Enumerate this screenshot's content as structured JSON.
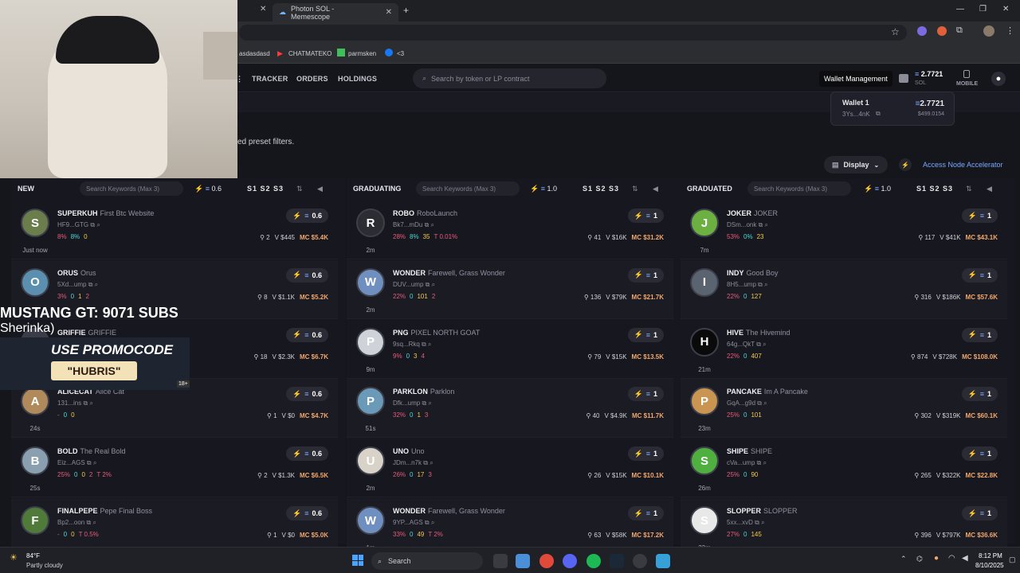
{
  "browser": {
    "tabs": [
      {
        "label": "Photon SOL - Memescope"
      }
    ],
    "bookmarks": [
      "asdasdasd",
      "CHATMATEKO",
      "parmsken",
      "<3"
    ]
  },
  "nav": {
    "tracker": "TRACKER",
    "orders": "ORDERS",
    "holdings": "HOLDINGS",
    "search_placeholder": "Search by token or LP contract",
    "tooltip": "Wallet Management",
    "balance": "2.7721",
    "balance_unit": "SOL",
    "mobile": "MOBILE"
  },
  "wallet_popup": {
    "name": "Wallet 1",
    "addr": "3Ys...4nK",
    "sol": "2.7721",
    "usd": "$499.0154"
  },
  "toolbar": {
    "preset_text": "ed preset filters.",
    "display": "Display",
    "access": "Access Node Accelerator"
  },
  "columns": [
    {
      "title": "NEW",
      "kw_placeholder": "Search Keywords (Max 3)",
      "preset_value": "0.6",
      "slots": "S1 S2 S3",
      "rows": [
        {
          "ticker": "SUPERKUH",
          "name": "First Btc Website",
          "addr": "HF9...GTG",
          "s1": "8%",
          "s2": "8%",
          "s3": "0",
          "s4": "",
          "s5": "",
          "holders": "2",
          "vol": "V $445",
          "mc": "MC $5.4K",
          "age": "Just now",
          "chip": "0.6",
          "av": "S",
          "avc": "#6a7d4a"
        },
        {
          "ticker": "ORUS",
          "name": "Orus",
          "addr": "5Xd...ump",
          "s1": "3%",
          "s2": "0",
          "s3": "1",
          "s4": "2",
          "s5": "",
          "holders": "8",
          "vol": "V $1.1K",
          "mc": "MC $5.2K",
          "age": "",
          "chip": "0.6",
          "av": "O",
          "avc": "#5a8fb0"
        },
        {
          "ticker": "GRIFFIE",
          "name": "GRIFFIE",
          "addr": "",
          "s1": "",
          "s2": "",
          "s3": "",
          "s4": "",
          "s5": "",
          "holders": "18",
          "vol": "V $2.3K",
          "mc": "MC $6.7K",
          "age": "",
          "chip": "0.6",
          "av": "G",
          "avc": "#3a3c48"
        },
        {
          "ticker": "ALICECAT",
          "name": "Alice Cat",
          "addr": "131...ins",
          "s1": "-",
          "s2": "0",
          "s3": "0",
          "s4": "",
          "s5": "",
          "holders": "1",
          "vol": "V $0",
          "mc": "MC $4.7K",
          "age": "24s",
          "chip": "0.6",
          "av": "A",
          "avc": "#b08a5a"
        },
        {
          "ticker": "BOLD",
          "name": "The Real Bold",
          "addr": "Eiz...AGS",
          "s1": "25%",
          "s2": "0",
          "s3": "0",
          "s4": "2",
          "s5": "T 2%",
          "holders": "2",
          "vol": "V $1.3K",
          "mc": "MC $6.5K",
          "age": "25s",
          "chip": "0.6",
          "av": "B",
          "avc": "#8aa0b0"
        },
        {
          "ticker": "FINALPEPE",
          "name": "Pepe Final Boss",
          "addr": "Bp2...oon",
          "s1": "-",
          "s2": "0",
          "s3": "0",
          "s4": "",
          "s5": "T 0.5%",
          "holders": "1",
          "vol": "V $0",
          "mc": "MC $5.0K",
          "age": "",
          "chip": "0.6",
          "av": "F",
          "avc": "#4f7a3a"
        }
      ]
    },
    {
      "title": "GRADUATING",
      "kw_placeholder": "Search Keywords (Max 3)",
      "preset_value": "1.0",
      "slots": "S1 S2 S3",
      "rows": [
        {
          "ticker": "ROBO",
          "name": "RoboLaunch",
          "addr": "Bk7...mDu",
          "s1": "28%",
          "s2": "8%",
          "s3": "35",
          "s4": "",
          "s5": "T 0.01%",
          "holders": "41",
          "vol": "V $16K",
          "mc": "MC $31.2K",
          "age": "2m",
          "chip": "1",
          "av": "R",
          "avc": "#2b2d33"
        },
        {
          "ticker": "WONDER",
          "name": "Farewell, Grass Wonder",
          "addr": "DUV...ump",
          "s1": "22%",
          "s2": "0",
          "s3": "101",
          "s4": "2",
          "s5": "",
          "holders": "136",
          "vol": "V $79K",
          "mc": "MC $21.7K",
          "age": "2m",
          "chip": "1",
          "av": "W",
          "avc": "#6f8fc0"
        },
        {
          "ticker": "PNG",
          "name": "PIXEL NORTH GOAT",
          "addr": "9sq...Rkq",
          "s1": "9%",
          "s2": "0",
          "s3": "3",
          "s4": "4",
          "s5": "",
          "holders": "79",
          "vol": "V $15K",
          "mc": "MC $13.5K",
          "age": "9m",
          "chip": "1",
          "av": "P",
          "avc": "#cfd2d8"
        },
        {
          "ticker": "PARKLON",
          "name": "Parklon",
          "addr": "Dfk...ump",
          "s1": "32%",
          "s2": "0",
          "s3": "1",
          "s4": "3",
          "s5": "",
          "holders": "40",
          "vol": "V $4.9K",
          "mc": "MC $11.7K",
          "age": "51s",
          "chip": "1",
          "av": "P",
          "avc": "#6a9ab8"
        },
        {
          "ticker": "UNO",
          "name": "Uno",
          "addr": "JDm...n7k",
          "s1": "26%",
          "s2": "0",
          "s3": "17",
          "s4": "3",
          "s5": "",
          "holders": "26",
          "vol": "V $15K",
          "mc": "MC $10.1K",
          "age": "2m",
          "chip": "1",
          "av": "U",
          "avc": "#d8d2c8"
        },
        {
          "ticker": "WONDER",
          "name": "Farewell, Grass Wonder",
          "addr": "9YP...AGS",
          "s1": "33%",
          "s2": "0",
          "s3": "49",
          "s4": "",
          "s5": "T 2%",
          "holders": "63",
          "vol": "V $58K",
          "mc": "MC $17.2K",
          "age": "1m",
          "chip": "1",
          "av": "W",
          "avc": "#6f8fc0"
        }
      ]
    },
    {
      "title": "GRADUATED",
      "kw_placeholder": "Search Keywords (Max 3)",
      "preset_value": "1.0",
      "slots": "S1 S2 S3",
      "rows": [
        {
          "ticker": "JOKER",
          "name": "JOKER",
          "addr": "DSm...onk",
          "s1": "53%",
          "s2": "0%",
          "s3": "23",
          "s4": "",
          "s5": "",
          "holders": "117",
          "vol": "V $41K",
          "mc": "MC $43.1K",
          "age": "7m",
          "chip": "1",
          "av": "J",
          "avc": "#6bb040"
        },
        {
          "ticker": "INDY",
          "name": "Good Boy",
          "addr": "8H5...ump",
          "s1": "22%",
          "s2": "0",
          "s3": "127",
          "s4": "",
          "s5": "",
          "holders": "316",
          "vol": "V $186K",
          "mc": "MC $57.6K",
          "age": "",
          "chip": "1",
          "av": "I",
          "avc": "#5a6470"
        },
        {
          "ticker": "HIVE",
          "name": "The Hivemind",
          "addr": "64g...QkT",
          "s1": "22%",
          "s2": "0",
          "s3": "407",
          "s4": "",
          "s5": "",
          "holders": "874",
          "vol": "V $728K",
          "mc": "MC $108.0K",
          "age": "21m",
          "chip": "1",
          "av": "H",
          "avc": "#0a0a0a"
        },
        {
          "ticker": "PANCAKE",
          "name": "Im A Pancake",
          "addr": "GqA...g9d",
          "s1": "25%",
          "s2": "0",
          "s3": "101",
          "s4": "",
          "s5": "",
          "holders": "302",
          "vol": "V $319K",
          "mc": "MC $60.1K",
          "age": "23m",
          "chip": "1",
          "av": "P",
          "avc": "#c99550"
        },
        {
          "ticker": "SHIPE",
          "name": "SHIPE",
          "addr": "cVa...ump",
          "s1": "25%",
          "s2": "0",
          "s3": "90",
          "s4": "",
          "s5": "",
          "holders": "265",
          "vol": "V $322K",
          "mc": "MC $22.8K",
          "age": "26m",
          "chip": "1",
          "av": "S",
          "avc": "#4fb040"
        },
        {
          "ticker": "SLOPPER",
          "name": "SLOPPER",
          "addr": "5xx...xvD",
          "s1": "27%",
          "s2": "0",
          "s3": "145",
          "s4": "",
          "s5": "",
          "holders": "396",
          "vol": "V $797K",
          "mc": "MC $36.6K",
          "age": "33m",
          "chip": "1",
          "av": "S",
          "avc": "#e8e8e8"
        }
      ]
    }
  ],
  "stream_overlay": {
    "line1": "MUSTANG GT: 9071 SUBS",
    "line2": "Sherinka)",
    "promo_top": "USE PROMOCODE",
    "promo_code": "\"HUBRIS\"",
    "promo_age": "18+"
  },
  "taskbar": {
    "temp": "84°F",
    "weather": "Partly cloudy",
    "search": "Search",
    "time": "8:12 PM",
    "date": "8/10/2025"
  }
}
